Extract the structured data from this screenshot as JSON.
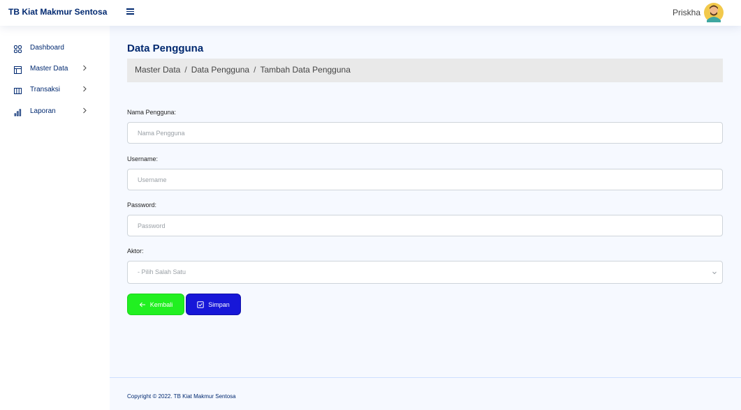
{
  "header": {
    "brand": "TB Kiat Makmur Sentosa",
    "user_name": "Priskha"
  },
  "sidebar": {
    "items": [
      {
        "label": "Dashboard",
        "icon": "grid-icon"
      },
      {
        "label": "Master Data",
        "icon": "layout-icon"
      },
      {
        "label": "Transaksi",
        "icon": "columns-icon"
      },
      {
        "label": "Laporan",
        "icon": "bar-chart-icon"
      }
    ]
  },
  "page": {
    "title": "Data Pengguna",
    "breadcrumb": [
      "Master Data",
      "Data Pengguna",
      "Tambah Data Pengguna"
    ],
    "separator": "/"
  },
  "form": {
    "nama": {
      "label": "Nama Pengguna:",
      "placeholder": "Nama Pengguna",
      "value": ""
    },
    "username": {
      "label": "Username:",
      "placeholder": "Username",
      "value": ""
    },
    "password": {
      "label": "Password:",
      "placeholder": "Password",
      "value": ""
    },
    "aktor": {
      "label": "Aktor:",
      "selected": "- Pilih Salah Satu"
    }
  },
  "buttons": {
    "back_label": "Kembali",
    "save_label": "Simpan"
  },
  "footer": {
    "copyright": "Copyright © 2022. TB Kiat Makmur Sentosa"
  },
  "colors": {
    "primary_text": "#012970",
    "back_button": "#21f021",
    "save_button": "#1717d8",
    "main_background": "#f6f9ff"
  }
}
